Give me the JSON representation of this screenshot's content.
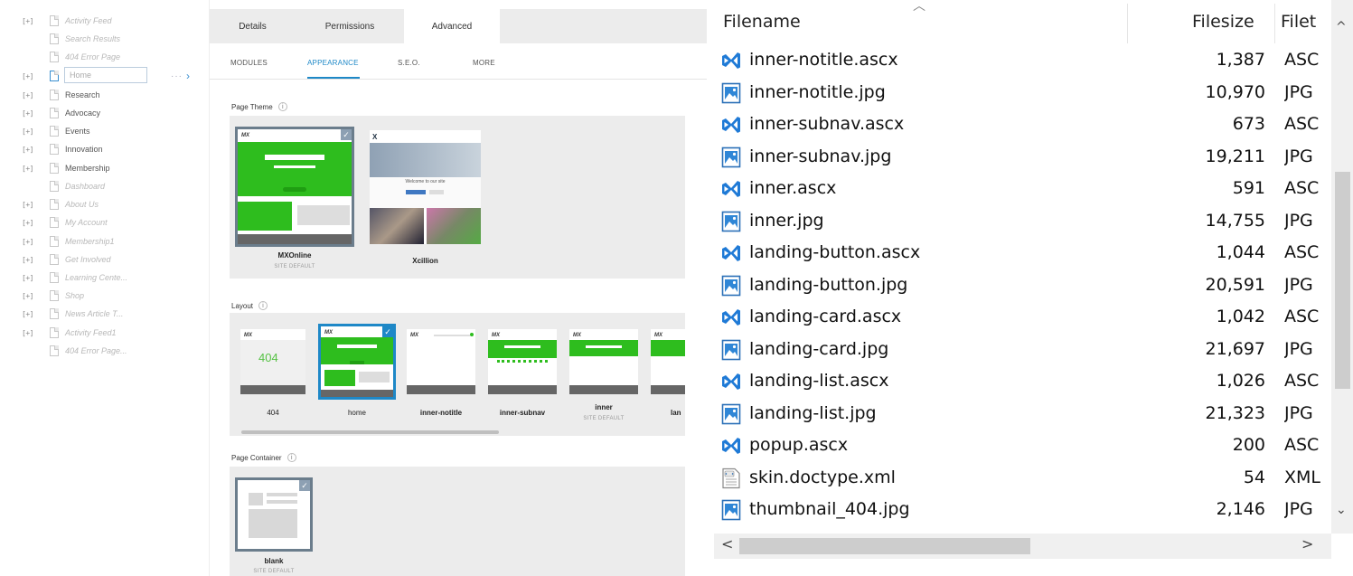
{
  "tree": {
    "items": [
      {
        "expander": "[+]",
        "label": "Activity Feed",
        "hidden": true
      },
      {
        "expander": "",
        "label": "Search Results",
        "hidden": true
      },
      {
        "expander": "",
        "label": "404 Error Page",
        "hidden": true
      },
      {
        "expander": "[+]",
        "label": "Home",
        "editing": true
      },
      {
        "expander": "[+]",
        "label": "Research",
        "hidden": false
      },
      {
        "expander": "[+]",
        "label": "Advocacy",
        "hidden": false
      },
      {
        "expander": "[+]",
        "label": "Events",
        "hidden": false
      },
      {
        "expander": "[+]",
        "label": "Innovation",
        "hidden": false
      },
      {
        "expander": "[+]",
        "label": "Membership",
        "hidden": false
      },
      {
        "expander": "",
        "label": "Dashboard",
        "hidden": true
      },
      {
        "expander": "[+]",
        "label": "About Us",
        "hidden": true
      },
      {
        "expander": "[+]",
        "label": "My Account",
        "hidden": true
      },
      {
        "expander": "[+]",
        "label": "Membership1",
        "hidden": true
      },
      {
        "expander": "[+]",
        "label": "Get Involved",
        "hidden": true
      },
      {
        "expander": "[+]",
        "label": "Learning Cente...",
        "hidden": true
      },
      {
        "expander": "[+]",
        "label": "Shop",
        "hidden": true
      },
      {
        "expander": "[+]",
        "label": "News Article T...",
        "hidden": true
      },
      {
        "expander": "[+]",
        "label": "Activity Feed1",
        "hidden": true
      },
      {
        "expander": "",
        "label": "404 Error Page...",
        "hidden": true
      }
    ],
    "dots": "···",
    "chevron": "›"
  },
  "panel": {
    "tabs": [
      "Details",
      "Permissions",
      "Advanced"
    ],
    "active_tab": "Advanced",
    "subtabs": [
      "MODULES",
      "APPEARANCE",
      "S.E.O.",
      "MORE"
    ],
    "active_subtab": "APPEARANCE",
    "page_theme": {
      "label": "Page Theme",
      "items": [
        {
          "name": "MXOnline",
          "sub": "SITE DEFAULT",
          "selected": true
        },
        {
          "name": "Xcillion",
          "sub": "",
          "selected": false,
          "welcome": "Welcome to our site"
        }
      ]
    },
    "layout": {
      "label": "Layout",
      "items": [
        {
          "name": "404",
          "sub": "",
          "big_text": "404"
        },
        {
          "name": "home",
          "sub": "",
          "selected": true
        },
        {
          "name": "inner-notitle",
          "sub": ""
        },
        {
          "name": "inner-subnav",
          "sub": ""
        },
        {
          "name": "inner",
          "sub": "SITE DEFAULT"
        },
        {
          "name": "lan",
          "sub": ""
        }
      ]
    },
    "page_container": {
      "label": "Page Container",
      "items": [
        {
          "name": "blank",
          "sub": "SITE DEFAULT",
          "selected": true
        }
      ]
    },
    "info_glyph": "i",
    "check_glyph": "✓",
    "logo_text": "MX"
  },
  "files": {
    "columns": {
      "name": "Filename",
      "size": "Filesize",
      "type": "Filet"
    },
    "sort_arrow": "︿",
    "rows": [
      {
        "name": "inner-notitle.ascx",
        "size": "1,387",
        "type": "ASC",
        "icon": "vscode-file-icon"
      },
      {
        "name": "inner-notitle.jpg",
        "size": "10,970",
        "type": "JPG",
        "icon": "image-file-icon"
      },
      {
        "name": "inner-subnav.ascx",
        "size": "673",
        "type": "ASC",
        "icon": "vscode-file-icon"
      },
      {
        "name": "inner-subnav.jpg",
        "size": "19,211",
        "type": "JPG",
        "icon": "image-file-icon"
      },
      {
        "name": "inner.ascx",
        "size": "591",
        "type": "ASC",
        "icon": "vscode-file-icon"
      },
      {
        "name": "inner.jpg",
        "size": "14,755",
        "type": "JPG",
        "icon": "image-file-icon"
      },
      {
        "name": "landing-button.ascx",
        "size": "1,044",
        "type": "ASC",
        "icon": "vscode-file-icon"
      },
      {
        "name": "landing-button.jpg",
        "size": "20,591",
        "type": "JPG",
        "icon": "image-file-icon"
      },
      {
        "name": "landing-card.ascx",
        "size": "1,042",
        "type": "ASC",
        "icon": "vscode-file-icon"
      },
      {
        "name": "landing-card.jpg",
        "size": "21,697",
        "type": "JPG",
        "icon": "image-file-icon"
      },
      {
        "name": "landing-list.ascx",
        "size": "1,026",
        "type": "ASC",
        "icon": "vscode-file-icon"
      },
      {
        "name": "landing-list.jpg",
        "size": "21,323",
        "type": "JPG",
        "icon": "image-file-icon"
      },
      {
        "name": "popup.ascx",
        "size": "200",
        "type": "ASC",
        "icon": "vscode-file-icon"
      },
      {
        "name": "skin.doctype.xml",
        "size": "54",
        "type": "XML",
        "icon": "xml-file-icon"
      },
      {
        "name": "thumbnail_404.jpg",
        "size": "2,146",
        "type": "JPG",
        "icon": "image-file-icon"
      }
    ],
    "scroll": {
      "up": "^",
      "down": "⌄",
      "left": "<",
      "right": ">"
    }
  }
}
